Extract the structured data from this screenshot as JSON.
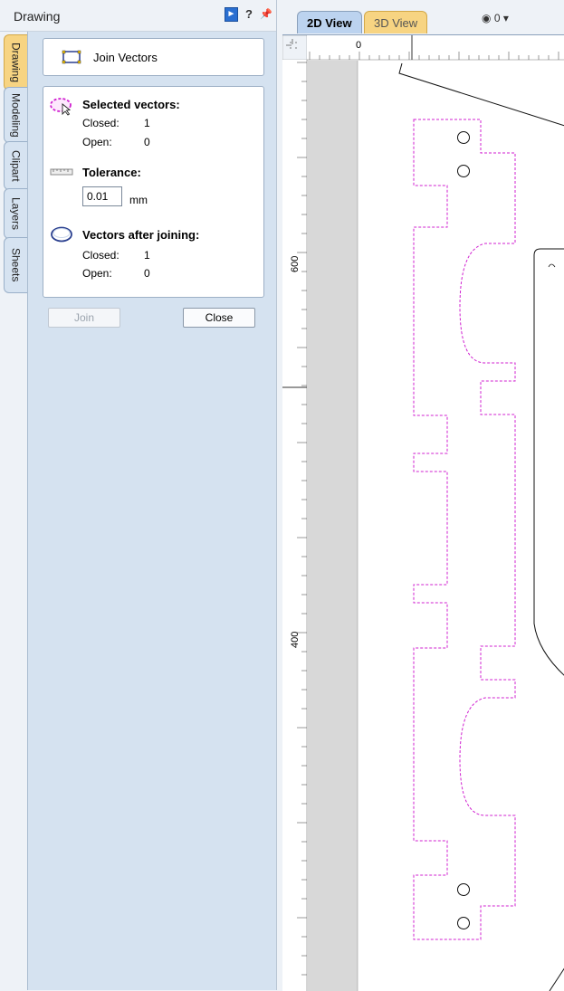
{
  "panel": {
    "title": "Drawing",
    "tabs": [
      "Drawing",
      "Modeling",
      "Clipart",
      "Layers",
      "Sheets"
    ]
  },
  "tool": {
    "title": "Join Vectors",
    "selected_title": "Selected vectors:",
    "selected_closed_label": "Closed:",
    "selected_closed_value": "1",
    "selected_open_label": "Open:",
    "selected_open_value": "0",
    "tolerance_title": "Tolerance:",
    "tolerance_value": "0.01",
    "tolerance_unit": "mm",
    "after_title": "Vectors after joining:",
    "after_closed_label": "Closed:",
    "after_closed_value": "1",
    "after_open_label": "Open:",
    "after_open_value": "0",
    "join_label": "Join",
    "close_label": "Close"
  },
  "view": {
    "tab_2d": "2D View",
    "tab_3d": "3D View",
    "layer_value": "0",
    "ruler_top_zero": "0",
    "ruler_left_600": "600",
    "ruler_left_400": "400"
  },
  "colors": {
    "selection": "#d020d0",
    "accent_tab": "#f7d482",
    "panel_bg": "#d5e2f0"
  }
}
